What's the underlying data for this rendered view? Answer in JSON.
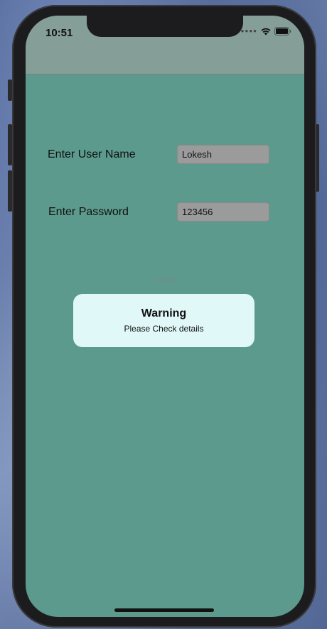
{
  "status_bar": {
    "time": "10:51",
    "icons": [
      "cellular-signal-icon",
      "wifi-icon",
      "battery-icon"
    ]
  },
  "form": {
    "username_label": "Enter User Name",
    "username_value": "Lokesh",
    "password_label": "Enter Password",
    "password_value": "123456",
    "login_label": "LogIn"
  },
  "alert": {
    "title": "Warning",
    "message": "Please Check details"
  },
  "colors": {
    "screen_background": "#5b9a8c",
    "top_bar": "#859e98",
    "field_background": "#9b9b9b",
    "alert_background": "#e0f8f7",
    "phone_frame": "#1c1c1e"
  }
}
